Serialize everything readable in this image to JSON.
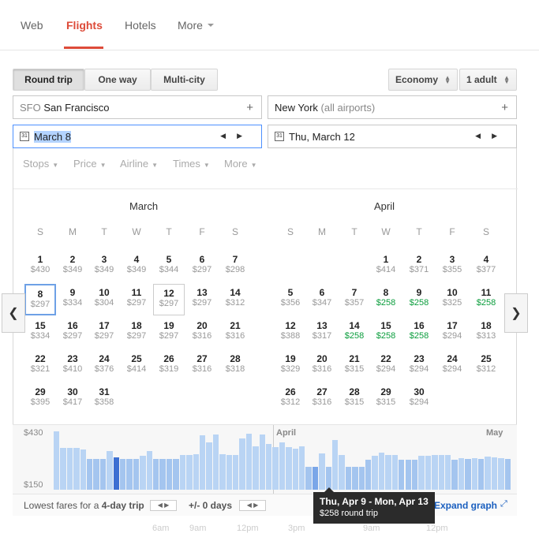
{
  "nav": {
    "tabs": [
      "Web",
      "Flights",
      "Hotels",
      "More"
    ],
    "active": "Flights"
  },
  "trip_type": {
    "round_trip": "Round trip",
    "one_way": "One way",
    "multi_city": "Multi-city",
    "selected": "Round trip"
  },
  "cabin": "Economy",
  "passengers": "1 adult",
  "origin": {
    "code": "SFO",
    "city": "San Francisco"
  },
  "destination": {
    "city": "New York",
    "qualifier": "(all airports)"
  },
  "depart_date": "March 8",
  "return_date": "Thu, March 12",
  "filters": [
    "Stops",
    "Price",
    "Airline",
    "Times",
    "More"
  ],
  "weekdays": [
    "S",
    "M",
    "T",
    "W",
    "T",
    "F",
    "S"
  ],
  "calendar": {
    "march": {
      "title": "March",
      "days": [
        {
          "d": "1",
          "p": "$430"
        },
        {
          "d": "2",
          "p": "$349"
        },
        {
          "d": "3",
          "p": "$349"
        },
        {
          "d": "4",
          "p": "$349"
        },
        {
          "d": "5",
          "p": "$344"
        },
        {
          "d": "6",
          "p": "$297"
        },
        {
          "d": "7",
          "p": "$298"
        },
        {
          "d": "8",
          "p": "$297"
        },
        {
          "d": "9",
          "p": "$334"
        },
        {
          "d": "10",
          "p": "$304"
        },
        {
          "d": "11",
          "p": "$297"
        },
        {
          "d": "12",
          "p": "$297"
        },
        {
          "d": "13",
          "p": "$297"
        },
        {
          "d": "14",
          "p": "$312"
        },
        {
          "d": "15",
          "p": "$334"
        },
        {
          "d": "16",
          "p": "$297"
        },
        {
          "d": "17",
          "p": "$297"
        },
        {
          "d": "18",
          "p": "$297"
        },
        {
          "d": "19",
          "p": "$297"
        },
        {
          "d": "20",
          "p": "$316"
        },
        {
          "d": "21",
          "p": "$316"
        },
        {
          "d": "22",
          "p": "$321"
        },
        {
          "d": "23",
          "p": "$410"
        },
        {
          "d": "24",
          "p": "$376"
        },
        {
          "d": "25",
          "p": "$414"
        },
        {
          "d": "26",
          "p": "$319"
        },
        {
          "d": "27",
          "p": "$316"
        },
        {
          "d": "28",
          "p": "$318"
        },
        {
          "d": "29",
          "p": "$395"
        },
        {
          "d": "30",
          "p": "$417"
        },
        {
          "d": "31",
          "p": "$358"
        }
      ]
    },
    "april": {
      "title": "April",
      "days": [
        {
          "d": "1",
          "p": "$414"
        },
        {
          "d": "2",
          "p": "$371"
        },
        {
          "d": "3",
          "p": "$355"
        },
        {
          "d": "4",
          "p": "$377"
        },
        {
          "d": "5",
          "p": "$356"
        },
        {
          "d": "6",
          "p": "$347"
        },
        {
          "d": "7",
          "p": "$357"
        },
        {
          "d": "8",
          "p": "$258",
          "g": true
        },
        {
          "d": "9",
          "p": "$258",
          "g": true
        },
        {
          "d": "10",
          "p": "$325"
        },
        {
          "d": "11",
          "p": "$258",
          "g": true
        },
        {
          "d": "12",
          "p": "$388"
        },
        {
          "d": "13",
          "p": "$317"
        },
        {
          "d": "14",
          "p": "$258",
          "g": true
        },
        {
          "d": "15",
          "p": "$258",
          "g": true
        },
        {
          "d": "16",
          "p": "$258",
          "g": true
        },
        {
          "d": "17",
          "p": "$294"
        },
        {
          "d": "18",
          "p": "$313"
        },
        {
          "d": "19",
          "p": "$329"
        },
        {
          "d": "20",
          "p": "$316"
        },
        {
          "d": "21",
          "p": "$315"
        },
        {
          "d": "22",
          "p": "$294"
        },
        {
          "d": "23",
          "p": "$294"
        },
        {
          "d": "24",
          "p": "$294"
        },
        {
          "d": "25",
          "p": "$312"
        },
        {
          "d": "26",
          "p": "$312"
        },
        {
          "d": "27",
          "p": "$316"
        },
        {
          "d": "28",
          "p": "$315"
        },
        {
          "d": "29",
          "p": "$315"
        },
        {
          "d": "30",
          "p": "$294"
        }
      ]
    }
  },
  "graph": {
    "y_max": "$430",
    "y_min": "$150",
    "month_labels": [
      "April",
      "May"
    ],
    "fares": [
      430,
      349,
      349,
      349,
      344,
      297,
      298,
      297,
      334,
      304,
      297,
      297,
      297,
      312,
      334,
      297,
      297,
      297,
      297,
      316,
      316,
      321,
      410,
      376,
      414,
      319,
      316,
      318,
      395,
      417,
      358,
      414,
      371,
      355,
      377,
      356,
      347,
      357,
      258,
      258,
      325,
      258,
      388,
      317,
      258,
      258,
      258,
      294,
      313,
      329,
      316,
      315,
      294,
      294,
      294,
      312,
      312,
      316,
      315,
      315,
      294,
      300,
      296,
      302,
      298,
      310,
      305,
      300,
      296
    ]
  },
  "footer": {
    "lowest_prefix": "Lowest fares for a",
    "trip_length": "4-day trip",
    "flex": "+/- 0 days",
    "expand": "Expand graph"
  },
  "tooltip": {
    "dates": "Thu, Apr 9 - Mon, Apr 13",
    "price": "$258 round trip"
  },
  "faint_times": [
    "6am",
    "9am",
    "12pm",
    "3pm",
    "9am",
    "12pm"
  ]
}
